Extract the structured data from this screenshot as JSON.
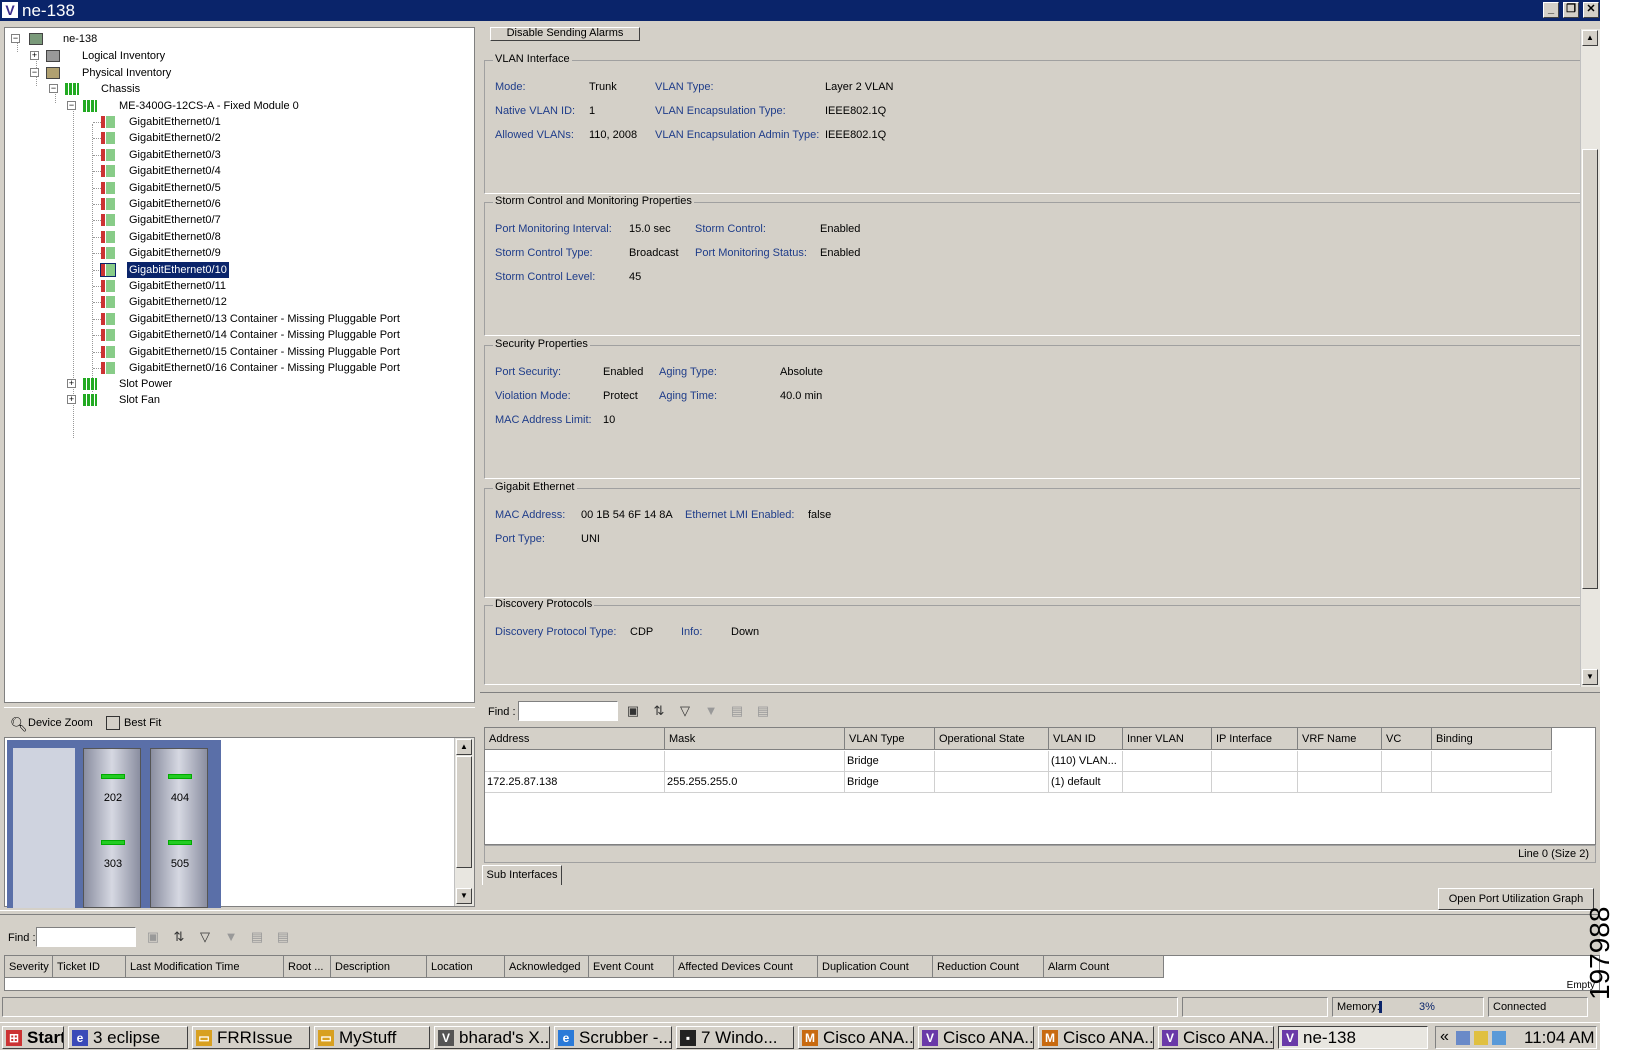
{
  "window": {
    "title": "ne-138",
    "logo": "V",
    "controls": [
      "_",
      "❐",
      "✕"
    ]
  },
  "tree": {
    "root": "ne-138",
    "logical": "Logical Inventory",
    "physical": "Physical Inventory",
    "chassis": "Chassis",
    "module": "ME-3400G-12CS-A - Fixed Module 0",
    "ports": [
      "GigabitEthernet0/1",
      "GigabitEthernet0/2",
      "GigabitEthernet0/3",
      "GigabitEthernet0/4",
      "GigabitEthernet0/5",
      "GigabitEthernet0/6",
      "GigabitEthernet0/7",
      "GigabitEthernet0/8",
      "GigabitEthernet0/9",
      "GigabitEthernet0/10",
      "GigabitEthernet0/11",
      "GigabitEthernet0/12",
      "GigabitEthernet0/13 Container - Missing Pluggable Port",
      "GigabitEthernet0/14 Container - Missing Pluggable Port",
      "GigabitEthernet0/15 Container - Missing Pluggable Port",
      "GigabitEthernet0/16 Container - Missing Pluggable Port"
    ],
    "selected_port": "GigabitEthernet0/10",
    "slot_power": "Slot Power",
    "slot_fan": "Slot Fan"
  },
  "device_view": {
    "zoom_label": "Device Zoom",
    "bestfit_label": "Best Fit",
    "slots": [
      "202",
      "404",
      "303",
      "505"
    ]
  },
  "details": {
    "partial_button": "Disable Sending Alarms",
    "vlan": {
      "title": "VLAN Interface",
      "mode_l": "Mode:",
      "mode_v": "Trunk",
      "vlantype_l": "VLAN Type:",
      "vlantype_v": "Layer 2 VLAN",
      "native_l": "Native VLAN ID:",
      "native_v": "1",
      "encap_l": "VLAN Encapsulation Type:",
      "encap_v": "IEEE802.1Q",
      "allowed_l": "Allowed VLANs:",
      "allowed_v": "110, 2008",
      "encapadmin_l": "VLAN Encapsulation Admin Type:",
      "encapadmin_v": "IEEE802.1Q"
    },
    "storm": {
      "title": "Storm Control and Monitoring Properties",
      "pmi_l": "Port Monitoring Interval:",
      "pmi_v": "15.0 sec",
      "sc_l": "Storm Control:",
      "sc_v": "Enabled",
      "sct_l": "Storm Control Type:",
      "sct_v": "Broadcast",
      "pms_l": "Port Monitoring Status:",
      "pms_v": "Enabled",
      "scl_l": "Storm Control Level:",
      "scl_v": "45"
    },
    "security": {
      "title": "Security Properties",
      "ps_l": "Port Security:",
      "ps_v": "Enabled",
      "at_l": "Aging Type:",
      "at_v": "Absolute",
      "vm_l": "Violation Mode:",
      "vm_v": "Protect",
      "atime_l": "Aging Time:",
      "atime_v": "40.0 min",
      "mal_l": "MAC Address Limit:",
      "mal_v": "10"
    },
    "gig": {
      "title": "Gigabit Ethernet",
      "mac_l": "MAC Address:",
      "mac_v": "00 1B 54 6F 14 8A",
      "lmi_l": "Ethernet LMI Enabled:",
      "lmi_v": "false",
      "pt_l": "Port Type:",
      "pt_v": "UNI"
    },
    "disc": {
      "title": "Discovery Protocols",
      "dpt_l": "Discovery Protocol Type:",
      "dpt_v": "CDP",
      "info_l": "Info:",
      "info_v": "Down"
    }
  },
  "sub_table": {
    "find_label": "Find :",
    "columns": [
      "Address",
      "Mask",
      "VLAN Type",
      "Operational State",
      "VLAN ID",
      "Inner VLAN",
      "IP Interface",
      "VRF Name",
      "VC",
      "Binding"
    ],
    "rows": [
      [
        "",
        "",
        "Bridge",
        "",
        "(110) VLAN...",
        "",
        "",
        "",
        "",
        ""
      ],
      [
        "172.25.87.138",
        "255.255.255.0",
        "Bridge",
        "",
        "(1) default",
        "",
        "",
        "",
        "",
        ""
      ]
    ],
    "status": "Line 0 (Size 2)",
    "tab": "Sub Interfaces",
    "graph_button": "Open Port Utilization Graph"
  },
  "alarm_table": {
    "find_label": "Find :",
    "columns": [
      "Severity",
      "Ticket ID",
      "Last Modification Time",
      "Root ...",
      "Description",
      "Location",
      "Acknowledged",
      "Event Count",
      "Affected Devices Count",
      "Duplication Count",
      "Reduction Count",
      "Alarm Count"
    ],
    "status": "Empty"
  },
  "statusbar": {
    "memory_label": "Memory:",
    "memory_pct": "3%",
    "memory_fraction": 0.03,
    "connection": "Connected"
  },
  "taskbar": {
    "start": "Start",
    "tasks": [
      "3 eclipse",
      "FRRIssue",
      "MyStuff",
      "bharad's X...",
      "Scrubber -...",
      "7 Windo...",
      "Cisco ANA...",
      "Cisco ANA...",
      "Cisco ANA...",
      "Cisco ANA...",
      "ne-138"
    ],
    "clock": "11:04 AM"
  },
  "figure_id": "197988"
}
